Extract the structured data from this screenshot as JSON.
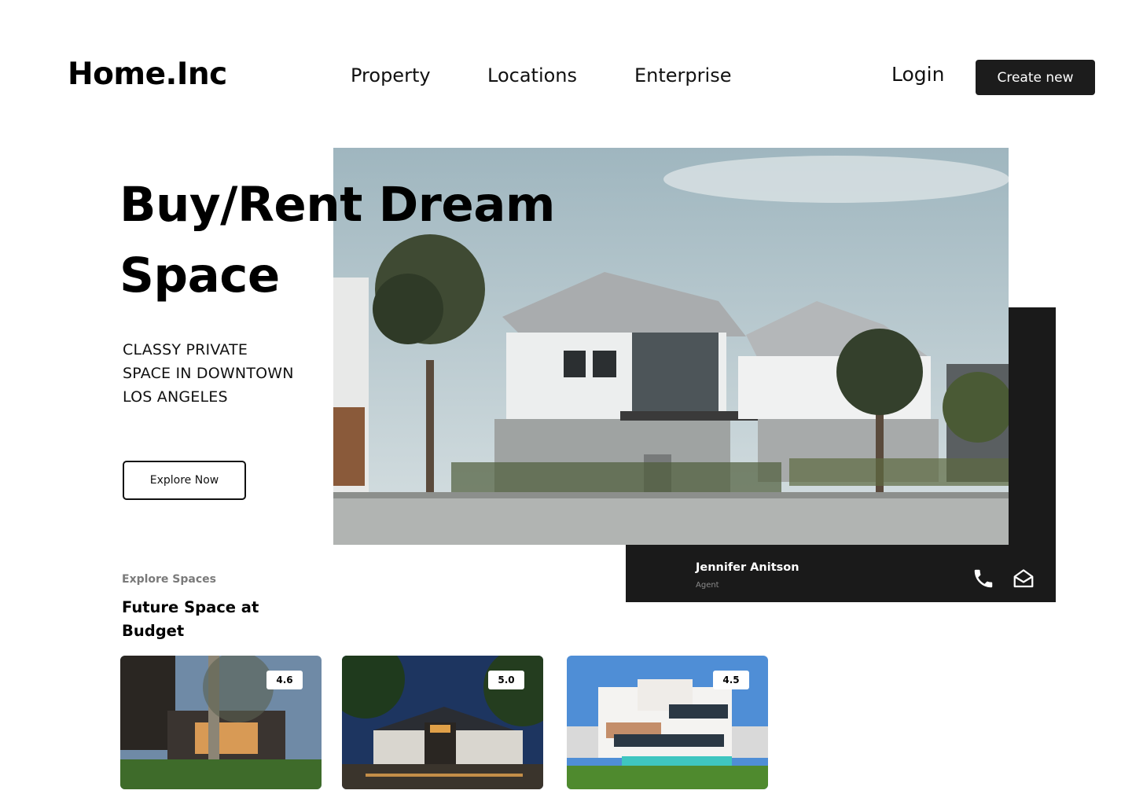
{
  "header": {
    "logo": "Home.Inc",
    "nav": [
      "Property",
      "Locations",
      "Enterprise"
    ],
    "login_label": "Login",
    "create_label": "Create new"
  },
  "hero": {
    "title_line1": "Buy/Rent Dream",
    "title_line2": "Space",
    "subtitle": "CLASSY PRIVATE SPACE IN DOWNTOWN LOS ANGELES",
    "cta_label": "Explore Now"
  },
  "agent": {
    "name": "Jennifer Anitson",
    "role": "Agent",
    "icons": [
      "phone-icon",
      "mail-open-icon"
    ]
  },
  "explore": {
    "label": "Explore Spaces",
    "title": "Future Space at Budget",
    "cards": [
      {
        "rating": "4.6"
      },
      {
        "rating": "5.0"
      },
      {
        "rating": "4.5"
      }
    ]
  }
}
